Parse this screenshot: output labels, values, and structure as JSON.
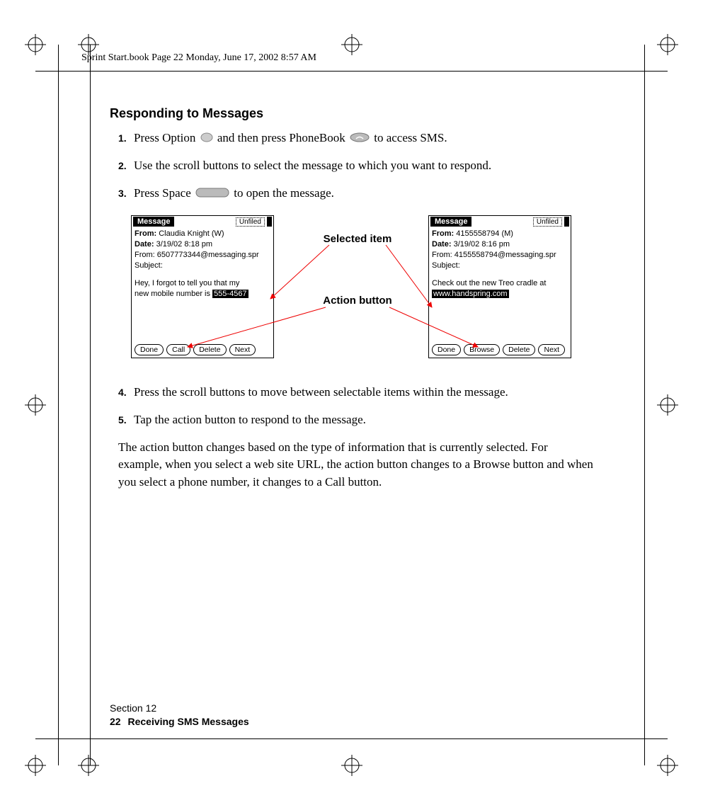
{
  "header": "Sprint Start.book  Page 22  Monday, June 17, 2002  8:57 AM",
  "heading": "Responding to Messages",
  "steps": {
    "s1num": "1.",
    "s1a": "Press Option ",
    "s1b": " and then press PhoneBook ",
    "s1c": " to access SMS.",
    "s2num": "2.",
    "s2": "Use the scroll buttons to select the message to which you want to respond.",
    "s3num": "3.",
    "s3a": "Press Space ",
    "s3b": " to open the message.",
    "s4num": "4.",
    "s4": "Press the scroll buttons to move between selectable items within the message.",
    "s5num": "5.",
    "s5": "Tap the action button to respond to the message."
  },
  "paragraph": "The action button changes based on the type of information that is currently selected. For example, when you select a web site URL, the action button changes to a Browse button and when you select a phone number, it changes to a Call button.",
  "callouts": {
    "selected": "Selected item",
    "action": "Action button"
  },
  "palmLeft": {
    "title": "Message",
    "tag": "Unfiled",
    "fromLabel": "From:",
    "fromValue": "  Claudia Knight (W)",
    "dateLabel": "Date:",
    "dateValue": "  3/19/02 8:18 pm",
    "line3": "From: 6507773344@messaging.spr",
    "line4": "Subject:",
    "body1": "Hey, I forgot to tell you that my",
    "body2a": "new mobile number is ",
    "body2sel": "555-4567",
    "btn1": "Done",
    "btn2": "Call",
    "btn3": "Delete",
    "btn4": "Next"
  },
  "palmRight": {
    "title": "Message",
    "tag": "Unfiled",
    "fromLabel": "From:",
    "fromValue": "  4155558794 (M)",
    "dateLabel": "Date:",
    "dateValue": "  3/19/02 8:16 pm",
    "line3": "From: 4155558794@messaging.spr",
    "line4": "Subject:",
    "body1": "Check out the new Treo cradle at",
    "body2sel": "www.handspring.com",
    "btn1": "Done",
    "btn2": "Browse",
    "btn3": "Delete",
    "btn4": "Next"
  },
  "footer": {
    "section": "Section 12",
    "pageNum": "22",
    "title": "Receiving SMS Messages"
  }
}
